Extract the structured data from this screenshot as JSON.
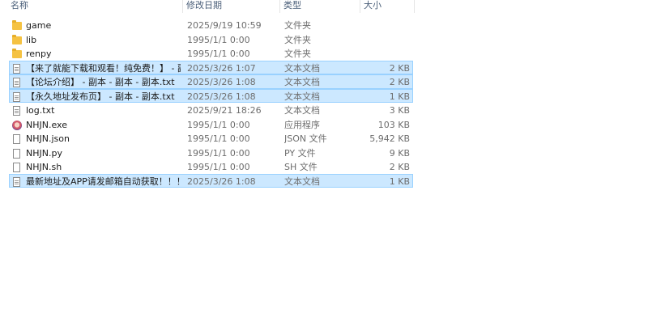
{
  "columns": {
    "name": "名称",
    "date": "修改日期",
    "type": "类型",
    "size": "大小"
  },
  "files": [
    {
      "name": "game",
      "date": "2025/9/19 10:59",
      "type": "文件夹",
      "size": "",
      "icon": "folder-icon",
      "selected": false
    },
    {
      "name": "lib",
      "date": "1995/1/1 0:00",
      "type": "文件夹",
      "size": "",
      "icon": "folder-icon",
      "selected": false
    },
    {
      "name": "renpy",
      "date": "1995/1/1 0:00",
      "type": "文件夹",
      "size": "",
      "icon": "folder-icon",
      "selected": false
    },
    {
      "name": "【来了就能下载和观看！纯免费！】 - 副...",
      "date": "2025/3/26 1:07",
      "type": "文本文档",
      "size": "2 KB",
      "icon": "text-document-icon",
      "selected": true
    },
    {
      "name": "【论坛介绍】 - 副本 - 副本 - 副本.txt",
      "date": "2025/3/26 1:08",
      "type": "文本文档",
      "size": "2 KB",
      "icon": "text-document-icon",
      "selected": true
    },
    {
      "name": "【永久地址发布页】 - 副本 - 副本.txt",
      "date": "2025/3/26 1:08",
      "type": "文本文档",
      "size": "1 KB",
      "icon": "text-document-icon",
      "selected": true
    },
    {
      "name": "log.txt",
      "date": "2025/9/21 18:26",
      "type": "文本文档",
      "size": "3 KB",
      "icon": "text-document-icon",
      "selected": false
    },
    {
      "name": "NHJN.exe",
      "date": "1995/1/1 0:00",
      "type": "应用程序",
      "size": "103 KB",
      "icon": "application-icon",
      "selected": false
    },
    {
      "name": "NHJN.json",
      "date": "1995/1/1 0:00",
      "type": "JSON 文件",
      "size": "5,942 KB",
      "icon": "file-icon",
      "selected": false
    },
    {
      "name": "NHJN.py",
      "date": "1995/1/1 0:00",
      "type": "PY 文件",
      "size": "9 KB",
      "icon": "file-icon",
      "selected": false
    },
    {
      "name": "NHJN.sh",
      "date": "1995/1/1 0:00",
      "type": "SH 文件",
      "size": "2 KB",
      "icon": "file-icon",
      "selected": false
    },
    {
      "name": "最新地址及APP请发邮箱自动获取！！！...",
      "date": "2025/3/26 1:08",
      "type": "文本文档",
      "size": "1 KB",
      "icon": "text-document-icon",
      "selected": true
    }
  ],
  "colors": {
    "selection_bg": "#cce8ff",
    "selection_border": "#99d1ff",
    "header_text": "#4c607a",
    "meta_text": "#6d6d6d"
  }
}
